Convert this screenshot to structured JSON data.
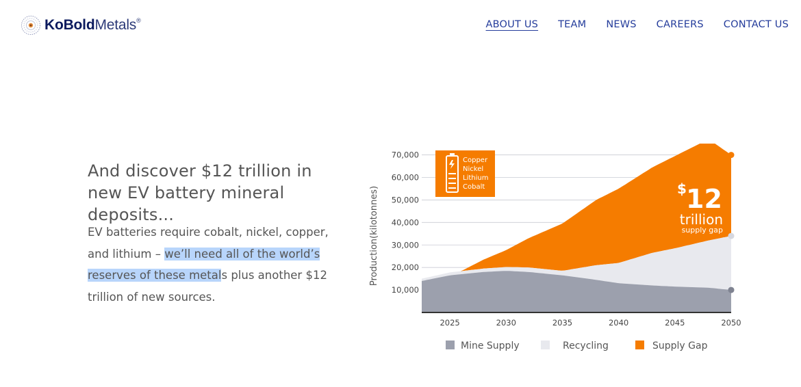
{
  "logo": {
    "brand_bold": "KoBold",
    "brand_rest": "Metals",
    "reg_mark": "®"
  },
  "nav": {
    "items": [
      {
        "label": "ABOUT US",
        "active": true
      },
      {
        "label": "TEAM",
        "active": false
      },
      {
        "label": "NEWS",
        "active": false
      },
      {
        "label": "CAREERS",
        "active": false
      },
      {
        "label": "CONTACT US",
        "active": false
      }
    ]
  },
  "content": {
    "heading": "And discover $12 trillion in new EV battery mineral deposits...",
    "body_part1": "EV batteries require cobalt, nickel, copper, and lithium – ",
    "body_highlight": "we’ll need all of the world’s reserves of these metal",
    "body_part2": "s plus another $12 trillion of new sources."
  },
  "chart_data": {
    "type": "area",
    "ylabel": "Production(kilotonnes)",
    "xlabel": "",
    "x_ticks": [
      2025,
      2030,
      2035,
      2040,
      2045,
      2050
    ],
    "y_ticks": [
      "10,000",
      "20,000",
      "30,000",
      "40,000",
      "50,000",
      "60,000",
      "70,000"
    ],
    "ylim": [
      0,
      72000
    ],
    "xlim": [
      2022.5,
      2050
    ],
    "grid": true,
    "legend_position": "bottom",
    "series": [
      {
        "name": "Mine Supply",
        "color": "#9ca0ad",
        "x": [
          2022.5,
          2025,
          2028,
          2030,
          2032,
          2035,
          2038,
          2040,
          2043,
          2045,
          2048,
          2050
        ],
        "values": [
          14000,
          16500,
          18000,
          18500,
          18000,
          16500,
          14500,
          13000,
          12000,
          11500,
          11000,
          10000
        ]
      },
      {
        "name": "Recycling",
        "color": "#e8e9ee",
        "x": [
          2022.5,
          2025,
          2028,
          2030,
          2032,
          2035,
          2038,
          2040,
          2043,
          2045,
          2048,
          2050
        ],
        "values": [
          1000,
          1300,
          1500,
          1700,
          2000,
          2000,
          6500,
          9000,
          14500,
          17000,
          21000,
          24000
        ]
      },
      {
        "name": "Supply Gap",
        "color": "#f57c00",
        "x": [
          2022.5,
          2025,
          2026,
          2028,
          2030,
          2032,
          2035,
          2038,
          2040,
          2043,
          2045,
          2048,
          2050
        ],
        "values": [
          0,
          0,
          0,
          4000,
          7500,
          13000,
          21000,
          29000,
          33000,
          38000,
          41000,
          45000,
          36000
        ]
      }
    ],
    "totals_end_markers": [
      70000,
      34000,
      10000
    ],
    "callout": {
      "currency": "$",
      "amount": "12",
      "unit": "trillion",
      "subtitle": "supply gap"
    },
    "badge": {
      "items": [
        "Copper",
        "Nickel",
        "Lithium",
        "Cobalt"
      ],
      "color": "#f57c00"
    },
    "colors": {
      "mine": "#9ca0ad",
      "recycling": "#e8e9ee",
      "gap": "#f57c00",
      "marker_recycling": "#d6d8e0",
      "marker_mine": "#7f8391"
    }
  }
}
